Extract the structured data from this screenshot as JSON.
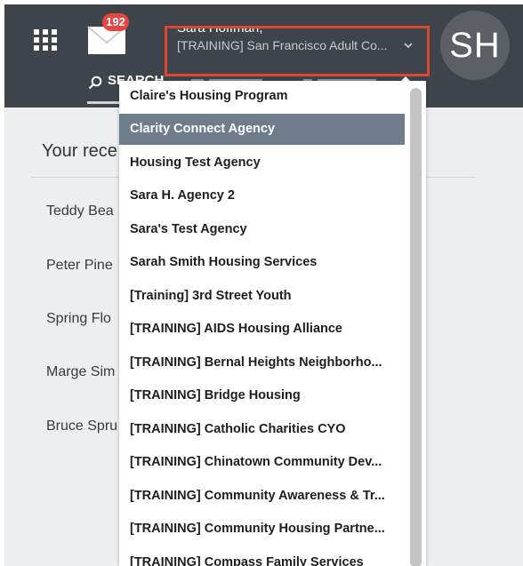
{
  "header": {
    "notification_count": "192",
    "user_name": "Sara Hoffman,",
    "agency": "[TRAINING] San Francisco Adult Co...",
    "avatar_initials": "SH",
    "nav_search_label": "SEARCH"
  },
  "recent": {
    "title": "Your rece",
    "items": [
      "Teddy Bea",
      "Peter Pine",
      "Spring Flo",
      "Marge Sim",
      "Bruce Spru"
    ]
  },
  "agency_dropdown": {
    "selected_index": 1,
    "items": [
      "Claire's Housing Program",
      "Clarity Connect Agency",
      "Housing Test Agency",
      "Sara H. Agency 2",
      "Sara's Test Agency",
      "Sarah Smith Housing Services",
      "[Training] 3rd Street Youth",
      "[TRAINING] AIDS Housing Alliance",
      "[TRAINING] Bernal Heights Neighborho...",
      "[TRAINING] Bridge Housing",
      "[TRAINING] Catholic Charities CYO",
      "[TRAINING] Chinatown Community Dev...",
      "[TRAINING] Community Awareness & Tr...",
      "[TRAINING] Community Housing Partne...",
      "[TRAINING] Compass Family Services"
    ]
  },
  "colors": {
    "topbar": "#3e4449",
    "highlight": "#dc4733",
    "badge": "#e84440",
    "selected_item": "#6f7c8c"
  }
}
